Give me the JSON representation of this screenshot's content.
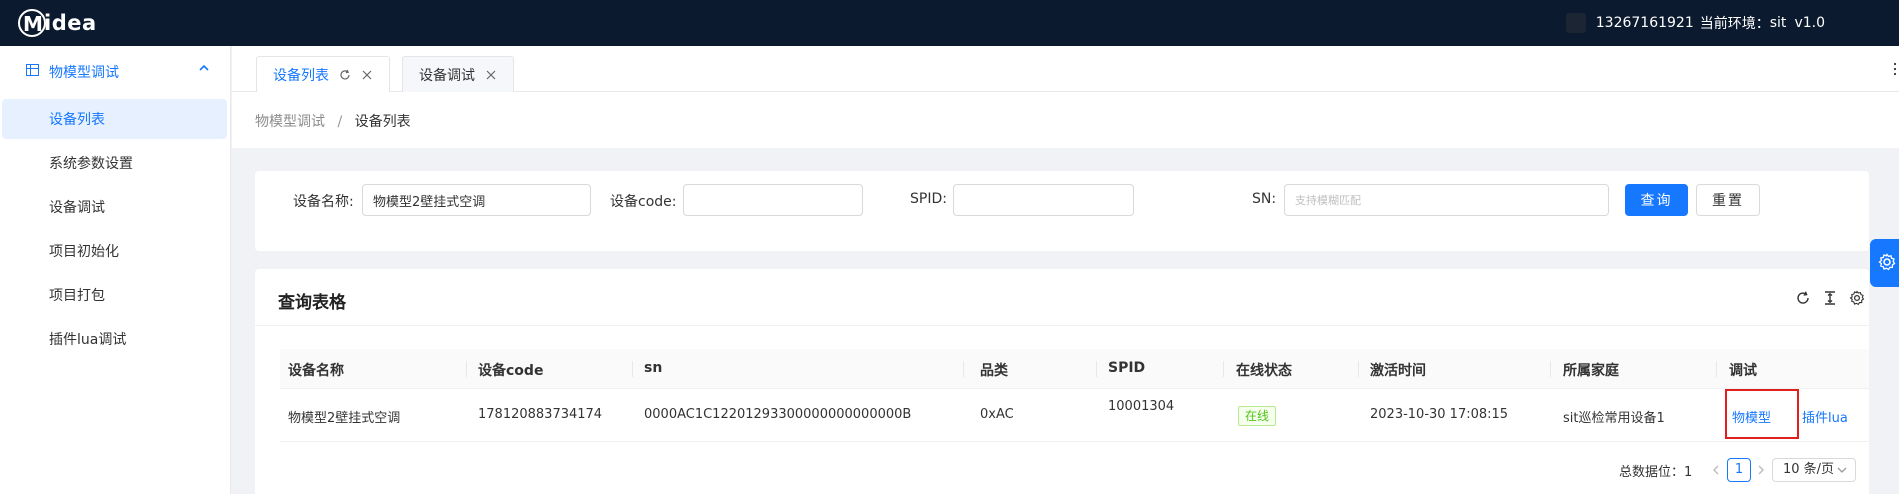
{
  "header": {
    "logo_text": "idea",
    "phone": "13267161921",
    "env_label": "当前环境：",
    "env_value": "sit",
    "version": "v1.0"
  },
  "sidebar": {
    "group_label": "物模型调试",
    "items": [
      {
        "label": "设备列表",
        "active": true
      },
      {
        "label": "系统参数设置"
      },
      {
        "label": "设备调试"
      },
      {
        "label": "项目初始化"
      },
      {
        "label": "项目打包"
      },
      {
        "label": "插件lua调试"
      }
    ]
  },
  "tabs": [
    {
      "label": "设备列表",
      "active": true
    },
    {
      "label": "设备调试"
    }
  ],
  "breadcrumb": {
    "parent": "物模型调试",
    "separator": "/",
    "current": "设备列表"
  },
  "search": {
    "device_name_label": "设备名称:",
    "device_name_value": "物模型2壁挂式空调",
    "device_code_label": "设备code:",
    "device_code_value": "",
    "spid_label": "SPID:",
    "spid_value": "",
    "sn_label": "SN:",
    "sn_placeholder": "支持模糊匹配",
    "query_button": "查询",
    "reset_button": "重置"
  },
  "table": {
    "title": "查询表格",
    "columns": [
      "设备名称",
      "设备code",
      "sn",
      "品类",
      "SPID",
      "在线状态",
      "激活时间",
      "所属家庭",
      "调试"
    ],
    "rows": [
      {
        "name": "物模型2壁挂式空调",
        "code": "178120883734174",
        "sn": "0000AC1C12201293300000000000000B",
        "category": "0xAC",
        "spid": "10001304",
        "status": "在线",
        "activated": "2023-10-30 17:08:15",
        "family": "sit巡检常用设备1",
        "action_model": "物模型",
        "action_lua": "插件lua"
      }
    ]
  },
  "pagination": {
    "total_label": "总数据位：",
    "total": "1",
    "current_page": "1",
    "page_size": "10 条/页"
  },
  "colors": {
    "accent": "#1677ff",
    "header_bg": "#0b1a2e",
    "online": "#52c41a",
    "highlight": "#e02020"
  }
}
